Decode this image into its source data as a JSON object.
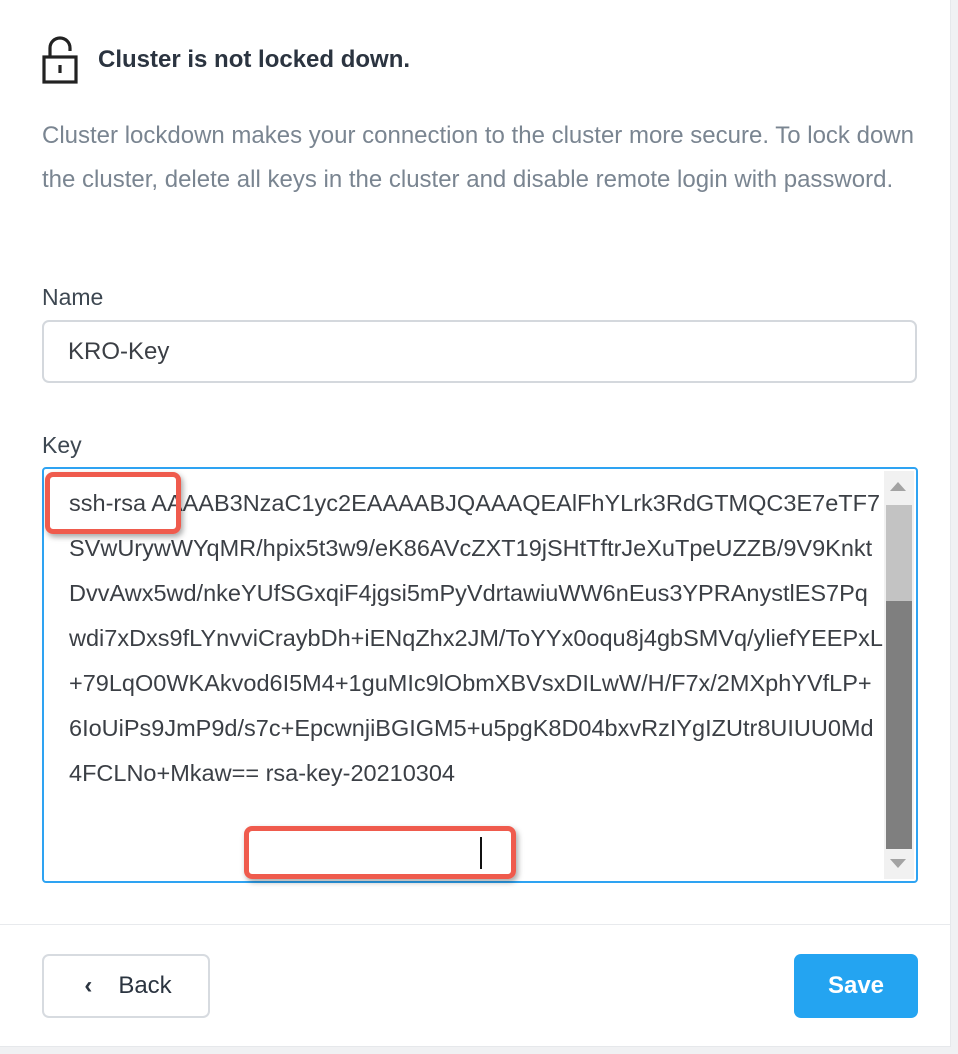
{
  "status": {
    "icon": "unlocked-padlock-icon",
    "text": "Cluster is not locked down."
  },
  "description": "Cluster lockdown makes your connection to the cluster more secure. To lock down the cluster, delete all keys in the cluster and disable remote login with password.",
  "name_field": {
    "label": "Name",
    "value": "KRO-Key"
  },
  "key_field": {
    "label": "Key",
    "value": "ssh-rsa AAAAB3NzaC1yc2EAAAABJQAAAQEAlFhYLrk3RdGTMQC3E7eTF7SVwUrywWYqMR/hpix5t3w9/eK86AVcZXT19jSHtTftrJeXuTpeUZZB/9V9KnktDvvAwx5wd/nkeYUfSGxqiF4jgsi5mPyVdrtawiuWW6nEus3YPRAnystlES7Pqwdi7xDxs9fLYnvviCraybDh+iENqZhx2JM/ToYYx0oqu8j4gbSMVq/yliefYEEPxL+79LqO0WKAkvod6I5M4+1guMIc9lObmXBVsxDILwW/H/F7x/2MXphYVfLP+6IoUiPs9JmP9d/s7c+EpcwnjiBGIGM5+u5pgK8D04bxvRzIYgIZUtr8UIUU0Md4FCLNo+Mkaw== rsa-key-20210304"
  },
  "buttons": {
    "back_label": "Back",
    "back_icon": "chevron-left-icon",
    "save_label": "Save"
  },
  "colors": {
    "accent": "#24a4f1",
    "highlight": "#ef5b4d",
    "focus_border": "#2ea3f2"
  }
}
